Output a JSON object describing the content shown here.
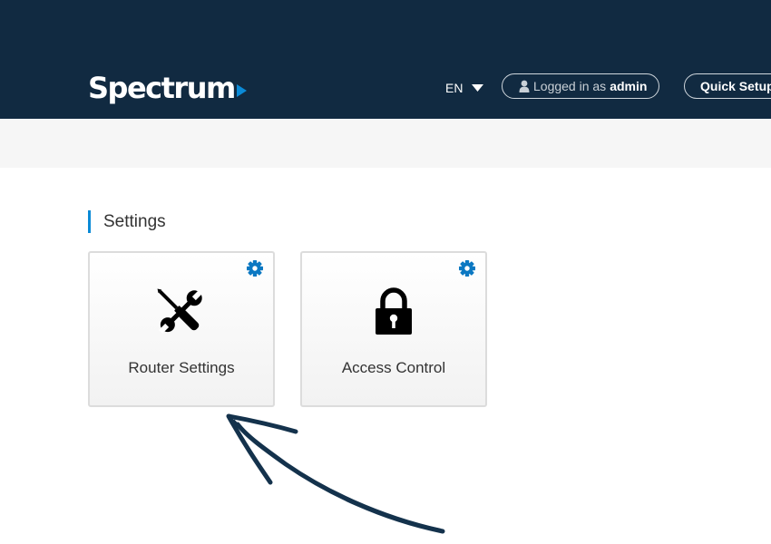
{
  "header": {
    "logo_text": "Spectrum",
    "language": "EN",
    "login_prefix": "Logged in as",
    "username": "admin",
    "quick_setup_label": "Quick Setup"
  },
  "section": {
    "title": "Settings"
  },
  "tiles": [
    {
      "label": "Router Settings",
      "icon": "tools-icon"
    },
    {
      "label": "Access Control",
      "icon": "lock-icon"
    }
  ],
  "colors": {
    "header_bg": "#112a41",
    "accent_blue": "#0b8ad6",
    "subbar_bg": "#f6f6f6",
    "arrow_ink": "#14324c"
  }
}
